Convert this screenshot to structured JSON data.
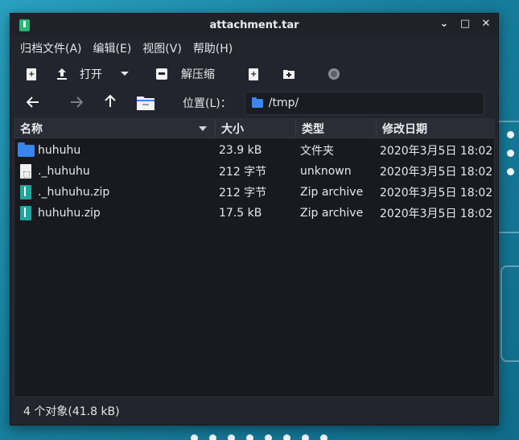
{
  "window": {
    "title": "attachment.tar",
    "controls": [
      "⌄",
      "□",
      "✕"
    ]
  },
  "menu": [
    "归档文件(A)",
    "编辑(E)",
    "视图(V)",
    "帮助(H)"
  ],
  "toolbar": {
    "open_label": "打开",
    "extract_label": "解压缩"
  },
  "location": {
    "label": "位置(L)：",
    "path": "/tmp/"
  },
  "columns": {
    "name": "名称",
    "size": "大小",
    "type": "类型",
    "modified": "修改日期"
  },
  "files": [
    {
      "name": "huhuhu",
      "size": "23.9 kB",
      "type": "文件夹",
      "modified": "2020年3月5日 18:02",
      "icon": "folder-icon"
    },
    {
      "name": "._huhuhu",
      "size": "212 字节",
      "type": "unknown",
      "modified": "2020年3月5日 18:02",
      "icon": "file-icon"
    },
    {
      "name": "._huhuhu.zip",
      "size": "212 字节",
      "type": "Zip archive",
      "modified": "2020年3月5日 18:02",
      "icon": "zip-file-icon"
    },
    {
      "name": "huhuhu.zip",
      "size": "17.5 kB",
      "type": "Zip archive",
      "modified": "2020年3月5日 18:02",
      "icon": "zip-file-icon"
    }
  ],
  "status": "4 个对象(41.8 kB)",
  "colors": {
    "desktop": "#1d8aa8",
    "window_bg": "#22252d",
    "list_bg": "#181a1f",
    "folder_blue": "#3a85ee",
    "zip_teal": "#1fa59e"
  }
}
